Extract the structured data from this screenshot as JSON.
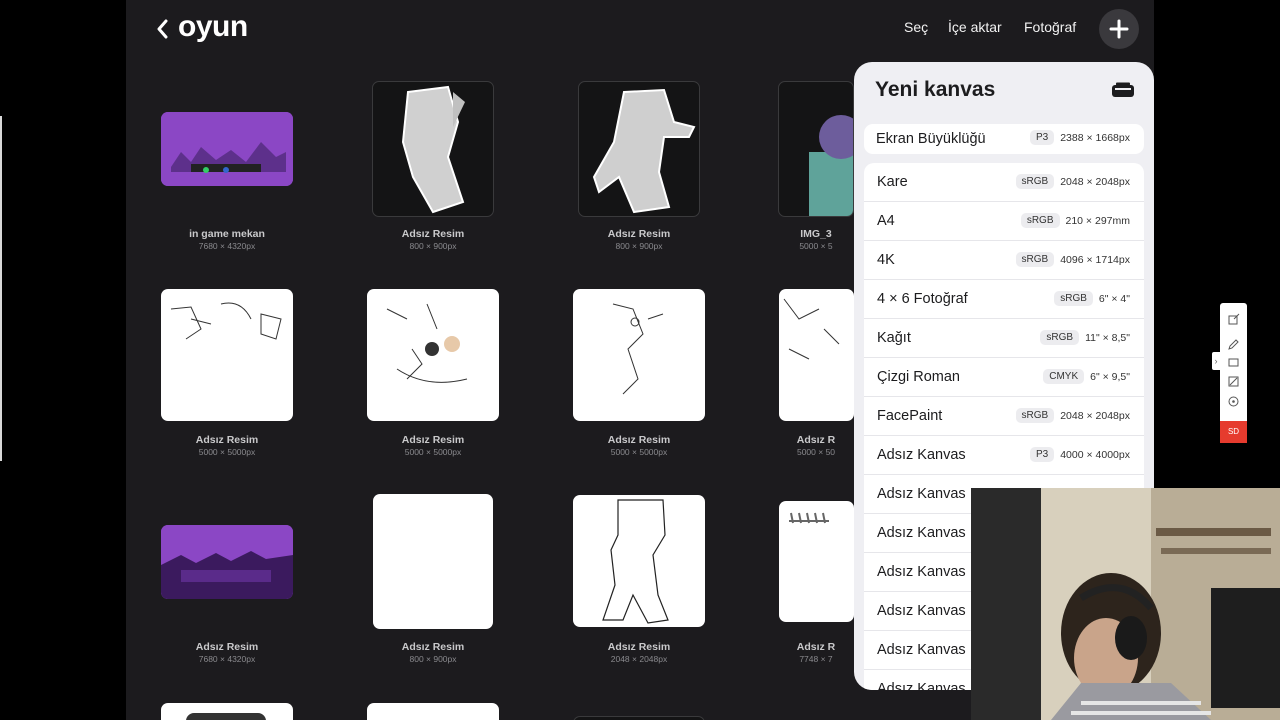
{
  "header": {
    "back_icon": "chevron-left-icon",
    "title": "oyun",
    "select_label": "Seç",
    "import_label": "İçe aktar",
    "photo_label": "Fotoğraf",
    "add_icon": "plus-icon"
  },
  "gallery": [
    {
      "name": "in game mekan",
      "size": "7680 × 4320px"
    },
    {
      "name": "Adsız Resim",
      "size": "800 × 900px"
    },
    {
      "name": "Adsız Resim",
      "size": "800 × 900px"
    },
    {
      "name": "IMG_3",
      "size": "5000 × 5"
    },
    {
      "name": "Adsız Resim",
      "size": "5000 × 5000px"
    },
    {
      "name": "Adsız Resim",
      "size": "5000 × 5000px"
    },
    {
      "name": "Adsız Resim",
      "size": "5000 × 5000px"
    },
    {
      "name": "Adsız R",
      "size": "5000 × 50"
    },
    {
      "name": "Adsız Resim",
      "size": "7680 × 4320px"
    },
    {
      "name": "Adsız Resim",
      "size": "800 × 900px"
    },
    {
      "name": "Adsız Resim",
      "size": "2048 × 2048px"
    },
    {
      "name": "Adsız R",
      "size": "7748 × 7"
    }
  ],
  "new_canvas": {
    "title": "Yeni kanvas",
    "create_icon": "new-canvas-icon",
    "screen_size": {
      "label": "Ekran Büyüklüğü",
      "profile": "P3",
      "dims": "2388 × 1668px"
    },
    "presets": [
      {
        "label": "Kare",
        "profile": "sRGB",
        "dims": "2048 × 2048px"
      },
      {
        "label": "A4",
        "profile": "sRGB",
        "dims": "210 × 297mm"
      },
      {
        "label": "4K",
        "profile": "sRGB",
        "dims": "4096 × 1714px"
      },
      {
        "label": "4 × 6 Fotoğraf",
        "profile": "sRGB",
        "dims": "6\" × 4\""
      },
      {
        "label": "Kağıt",
        "profile": "sRGB",
        "dims": "11\" × 8,5\""
      },
      {
        "label": "Çizgi Roman",
        "profile": "CMYK",
        "dims": "6\" × 9,5\""
      },
      {
        "label": "FacePaint",
        "profile": "sRGB",
        "dims": "2048 × 2048px"
      },
      {
        "label": "Adsız Kanvas",
        "profile": "P3",
        "dims": "4000 × 4000px"
      },
      {
        "label": "Adsız Kanvas"
      },
      {
        "label": "Adsız Kanvas"
      },
      {
        "label": "Adsız Kanvas"
      },
      {
        "label": "Adsız Kanvas"
      },
      {
        "label": "Adsız Kanvas"
      },
      {
        "label": "Adsız Kanvas"
      }
    ]
  },
  "overlay_tools": {
    "icons": [
      "export-icon",
      "pen-icon",
      "rectangle-icon",
      "crop-icon",
      "target-icon"
    ],
    "record_label": "SD"
  },
  "colors": {
    "app_bg": "#1c1b1e",
    "popover_bg": "#efeff3",
    "purple_thumb": "#8b47c5",
    "record_red": "#e63b2e"
  }
}
